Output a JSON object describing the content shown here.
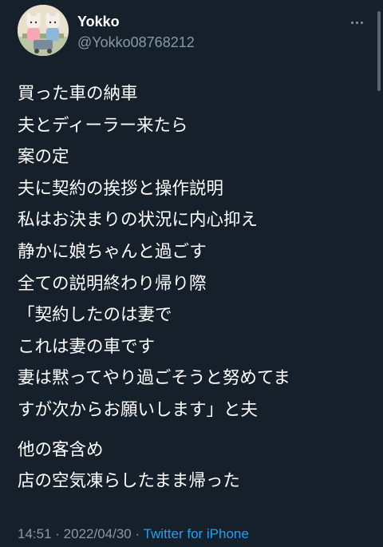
{
  "tweet": {
    "user": {
      "display_name": "Yokko",
      "handle": "@Yokko08768212"
    },
    "text": {
      "paragraphs": [
        [
          "買った車の納車",
          "夫とディーラー来たら",
          "案の定",
          "夫に契約の挨拶と操作説明",
          "私はお決まりの状況に内心抑え",
          "静かに娘ちゃんと過ごす",
          "全ての説明終わり帰り際",
          "「契約したのは妻で",
          "これは妻の車です",
          "妻は黙ってやり過ごそうと努めてま",
          "すが次からお願いします」と夫"
        ],
        [
          "他の客含め",
          "店の空気凍らしたまま帰った"
        ]
      ]
    },
    "meta": {
      "time": "14:51",
      "separator_1": " · ",
      "date": "2022/04/30",
      "separator_2": " · ",
      "source": "Twitter for iPhone"
    }
  },
  "colors": {
    "background": "#15202b",
    "text": "#ffffff",
    "secondary": "#8899a6",
    "link": "#1da1f2"
  },
  "icons": {
    "more": "more-horizontal-icon",
    "avatar": "avatar-image"
  }
}
